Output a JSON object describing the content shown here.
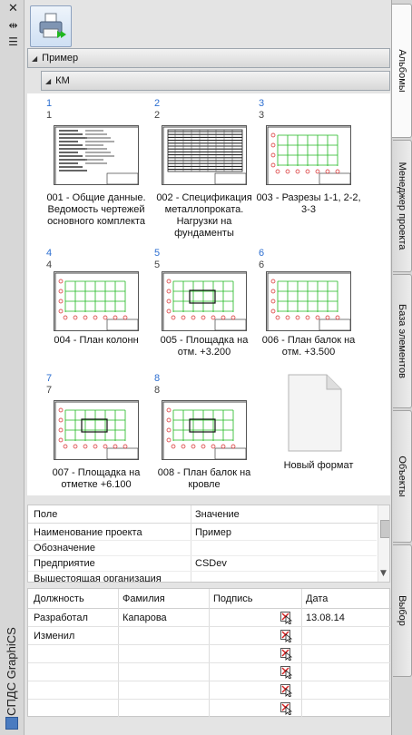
{
  "palette": {
    "title": "СПДС GraphiCS",
    "left_icons": [
      "close-icon",
      "pin-icon",
      "menu-icon"
    ]
  },
  "toolbar": {
    "print_button_icon": "printer-icon"
  },
  "tree": {
    "album_label": "Пример",
    "section_label": "КМ"
  },
  "sheets": [
    {
      "link": "1",
      "num": "1",
      "caption": "001 - Общие данные. Ведомость чертежей основного комплекта"
    },
    {
      "link": "2",
      "num": "2",
      "caption": "002 - Спецификация металлопроката. Нагрузки на фундаменты"
    },
    {
      "link": "3",
      "num": "3",
      "caption": "003 - Разрезы 1-1, 2-2, 3-3"
    },
    {
      "link": "4",
      "num": "4",
      "caption": "004 - План колонн"
    },
    {
      "link": "5",
      "num": "5",
      "caption": "005 - Площадка на отм. +3.200"
    },
    {
      "link": "6",
      "num": "6",
      "caption": "006 - План балок на отм. +3.500"
    },
    {
      "link": "7",
      "num": "7",
      "caption": "007 - Площадка на отметке +6.100"
    },
    {
      "link": "8",
      "num": "8",
      "caption": "008 - План балок на кровле"
    }
  ],
  "new_format": {
    "label": "Новый формат"
  },
  "properties": {
    "headers": [
      "Поле",
      "Значение"
    ],
    "rows": [
      {
        "field": "Наименование проекта",
        "value": "Пример"
      },
      {
        "field": "Обозначение",
        "value": ""
      },
      {
        "field": "Предприятие",
        "value": "CSDev"
      },
      {
        "field": "Вышестоящая организация",
        "value": ""
      }
    ]
  },
  "signatures": {
    "headers": [
      "Должность",
      "Фамилия",
      "Подпись",
      "Дата"
    ],
    "rows": [
      {
        "role": "Разработал",
        "name": "Капарова",
        "date": "13.08.14"
      },
      {
        "role": "Изменил",
        "name": "",
        "date": ""
      },
      {
        "role": "",
        "name": "",
        "date": ""
      },
      {
        "role": "",
        "name": "",
        "date": ""
      },
      {
        "role": "",
        "name": "",
        "date": ""
      },
      {
        "role": "",
        "name": "",
        "date": ""
      }
    ]
  },
  "tabs": [
    {
      "label": "Альбомы",
      "active": true
    },
    {
      "label": "Менеджер проекта",
      "active": false
    },
    {
      "label": "База элементов",
      "active": false
    },
    {
      "label": "Объекты",
      "active": false
    },
    {
      "label": "Выбор",
      "active": false
    }
  ],
  "colors": {
    "link": "#2d6fd1",
    "drawing_green": "#1fb81f",
    "drawing_red": "#d62020"
  }
}
